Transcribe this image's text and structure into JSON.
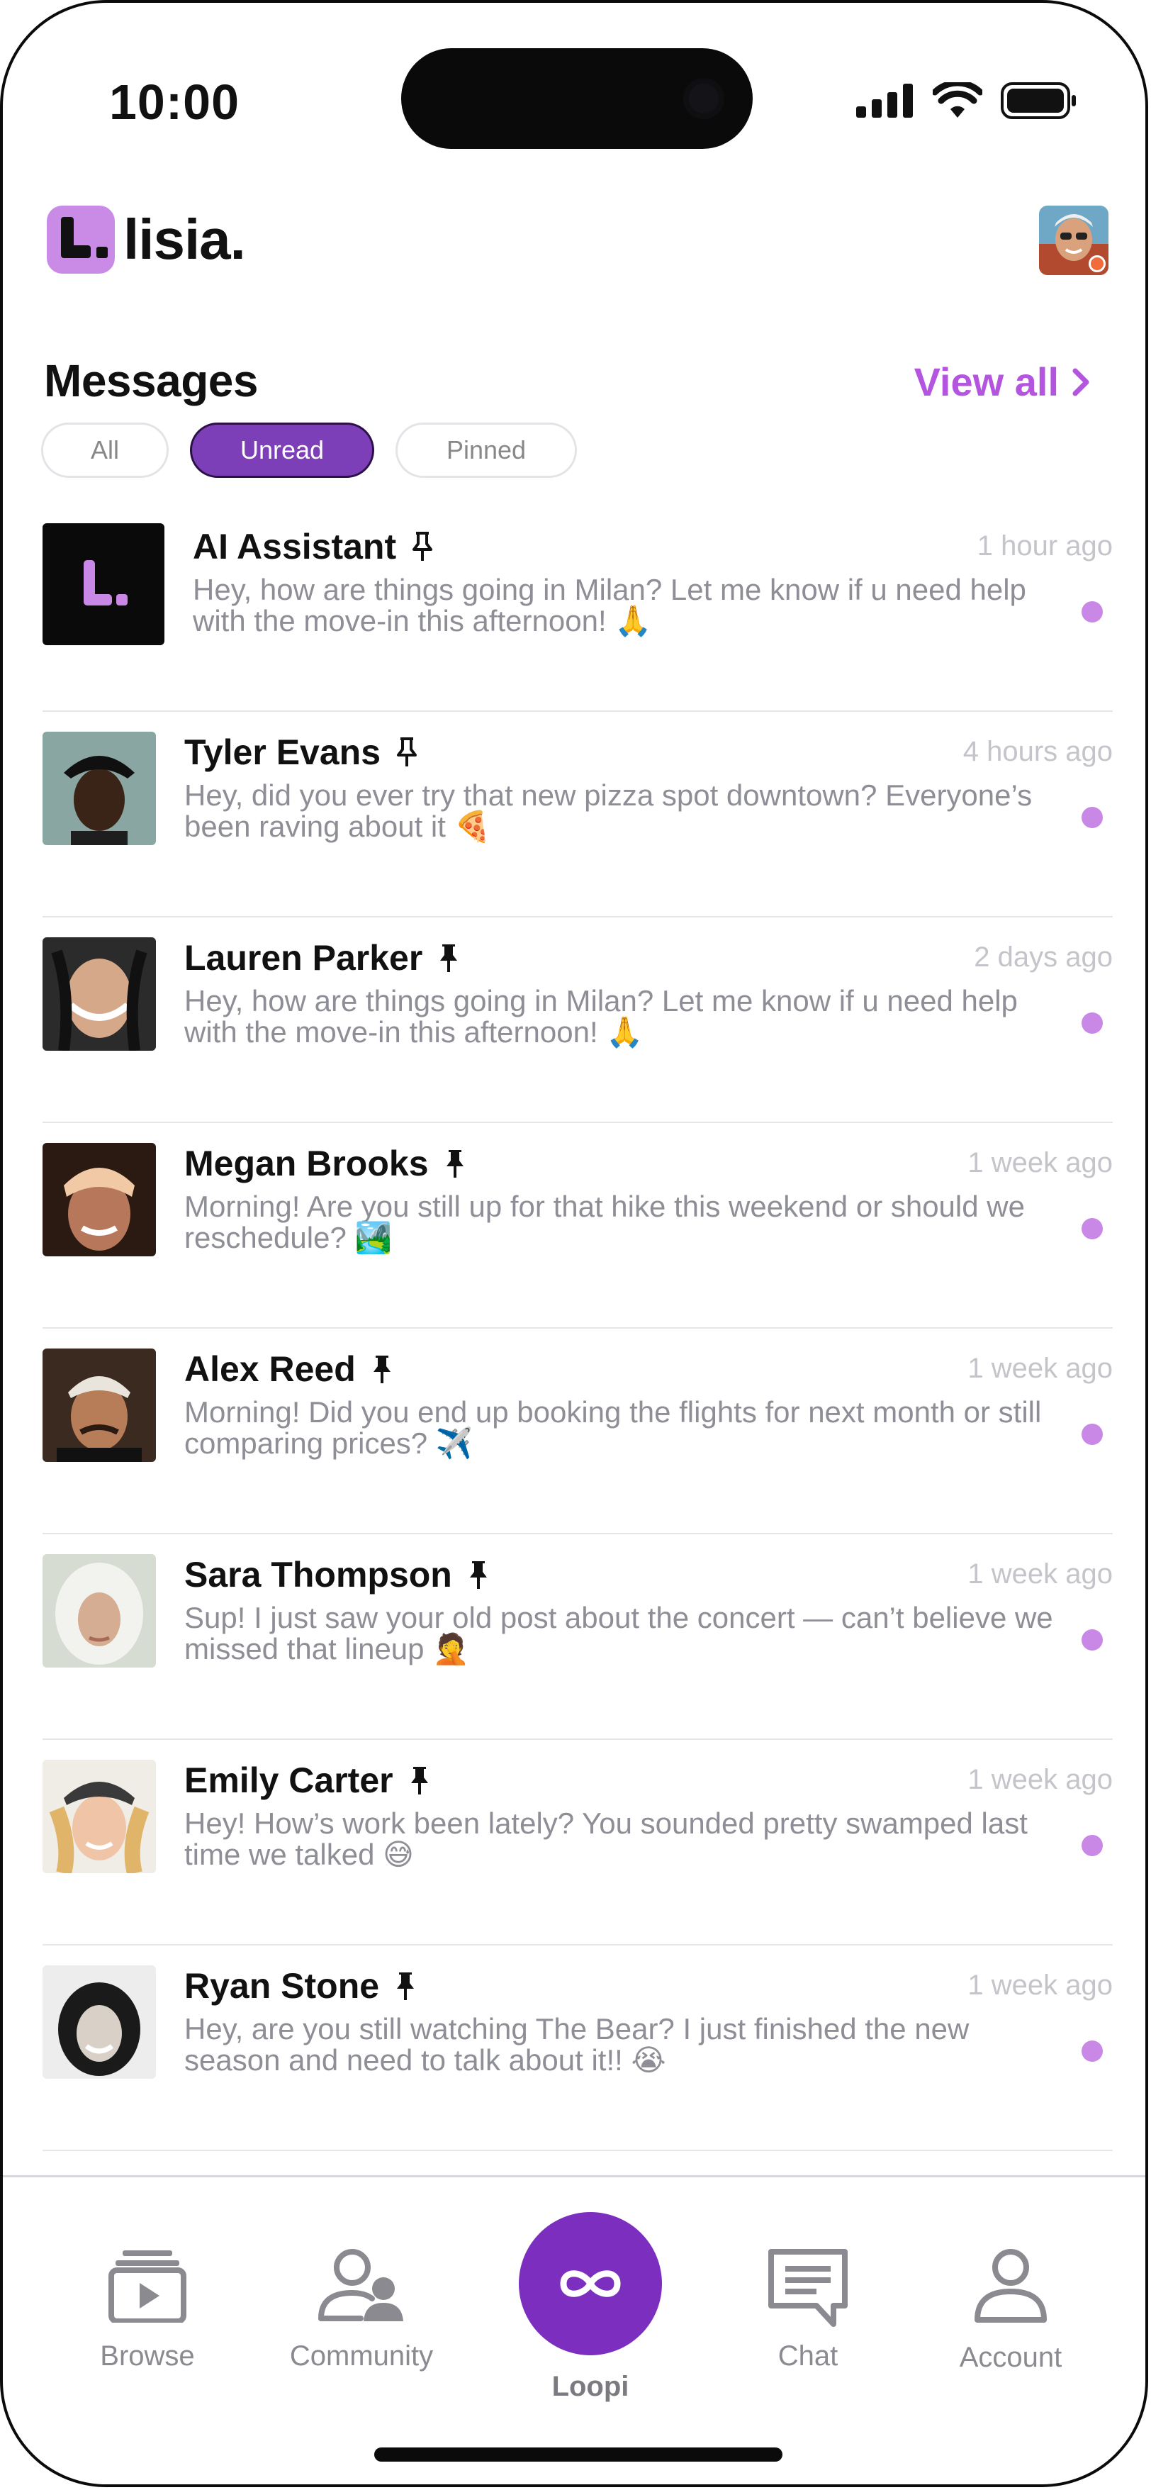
{
  "status_bar": {
    "time": "10:00"
  },
  "brand": {
    "name": "lisia."
  },
  "messages": {
    "title": "Messages",
    "view_all": "View all",
    "filters": [
      "All",
      "Unread",
      "Pinned"
    ],
    "active_filter": "Unread",
    "items": [
      {
        "name": "AI Assistant",
        "time": "1 hour ago",
        "preview": "Hey, how are things going in Milan? Let me know if u need help with the move-in this afternoon! 🙏",
        "pinned": true,
        "unread": true
      },
      {
        "name": "Tyler Evans",
        "time": "4 hours ago",
        "preview": "Hey, did you ever try that new pizza spot downtown? Everyone’s been raving about it 🍕",
        "pinned": true,
        "unread": true
      },
      {
        "name": "Lauren Parker",
        "time": "2 days ago",
        "preview": "Hey, how are things going in Milan? Let me know if u need help with the move-in this afternoon! 🙏",
        "pinned": true,
        "unread": true
      },
      {
        "name": "Megan Brooks",
        "time": "1 week ago",
        "preview": "Morning! Are you still up for that hike this weekend or should we reschedule? 🏞️",
        "pinned": true,
        "unread": true
      },
      {
        "name": "Alex Reed",
        "time": "1 week ago",
        "preview": "Morning! Did you end up booking the flights for next month or still comparing prices? ✈️",
        "pinned": true,
        "unread": true
      },
      {
        "name": "Sara Thompson",
        "time": "1 week ago",
        "preview": "Sup! I just saw your old post about the concert — can’t believe we missed that lineup 🤦",
        "pinned": true,
        "unread": true
      },
      {
        "name": "Emily Carter",
        "time": "1 week ago",
        "preview": "Hey! How’s work been lately? You sounded pretty swamped last time we talked 😅",
        "pinned": true,
        "unread": true
      },
      {
        "name": "Ryan Stone",
        "time": "1 week ago",
        "preview": "Hey, are you still watching The Bear? I just finished the new season and need to talk about it!! 😭",
        "pinned": true,
        "unread": true
      }
    ]
  },
  "nav": {
    "browse": "Browse",
    "community": "Community",
    "loopi": "Loopi",
    "chat": "Chat",
    "account": "Account"
  },
  "colors": {
    "accent": "#7d3fb7",
    "accent_light": "#c988e6",
    "link": "#b455e0"
  }
}
